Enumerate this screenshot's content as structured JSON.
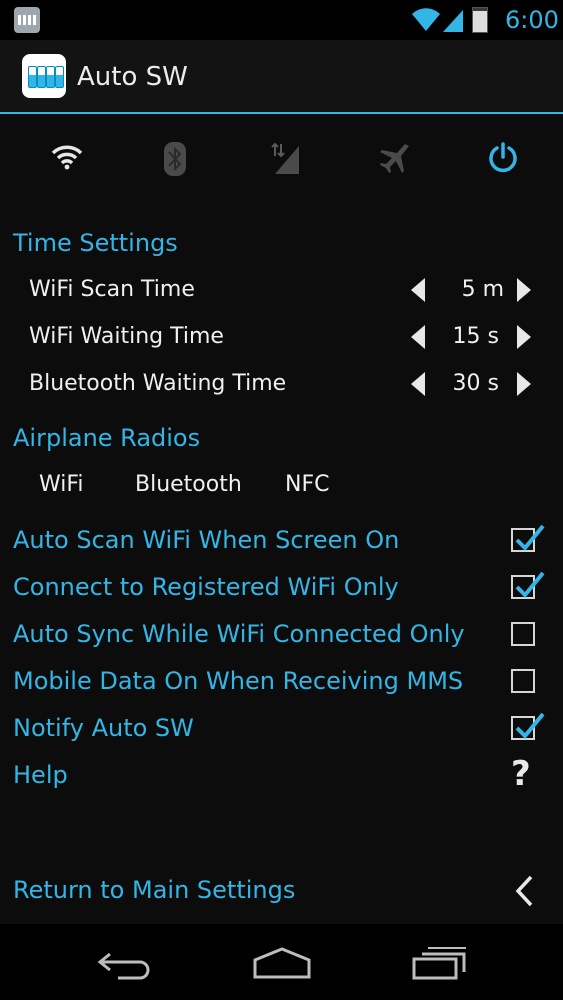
{
  "status_bar": {
    "time": "6:00",
    "icons": [
      "app-notification-icon",
      "wifi-icon",
      "signal-icon",
      "battery-icon"
    ]
  },
  "action_bar": {
    "title": "Auto SW",
    "logo": "auto-sw-logo-icon"
  },
  "toggles": [
    {
      "icon": "wifi-icon",
      "active": false
    },
    {
      "icon": "bluetooth-icon",
      "active": false
    },
    {
      "icon": "mobile-data-icon",
      "active": false
    },
    {
      "icon": "airplane-icon",
      "active": false
    },
    {
      "icon": "power-icon",
      "active": true
    }
  ],
  "time_settings": {
    "header": "Time Settings",
    "items": [
      {
        "label": "WiFi Scan Time",
        "value": "5 m"
      },
      {
        "label": "WiFi Waiting Time",
        "value": "15 s"
      },
      {
        "label": "Bluetooth Waiting Time",
        "value": "30 s"
      }
    ]
  },
  "airplane_radios": {
    "header": "Airplane Radios",
    "items": [
      "WiFi",
      "Bluetooth",
      "NFC"
    ]
  },
  "preferences": [
    {
      "label": "Auto Scan WiFi When Screen On",
      "checked": true
    },
    {
      "label": "Connect to Registered WiFi Only",
      "checked": true
    },
    {
      "label": "Auto Sync While WiFi Connected Only",
      "checked": false
    },
    {
      "label": "Mobile Data On When Receiving MMS",
      "checked": false
    },
    {
      "label": "Notify Auto SW",
      "checked": true
    }
  ],
  "help": {
    "label": "Help",
    "icon_glyph": "?"
  },
  "return": {
    "label": "Return to Main Settings"
  },
  "colors": {
    "accent": "#33b5e5",
    "background": "#0c0c0c",
    "text": "#f0f0f0"
  }
}
